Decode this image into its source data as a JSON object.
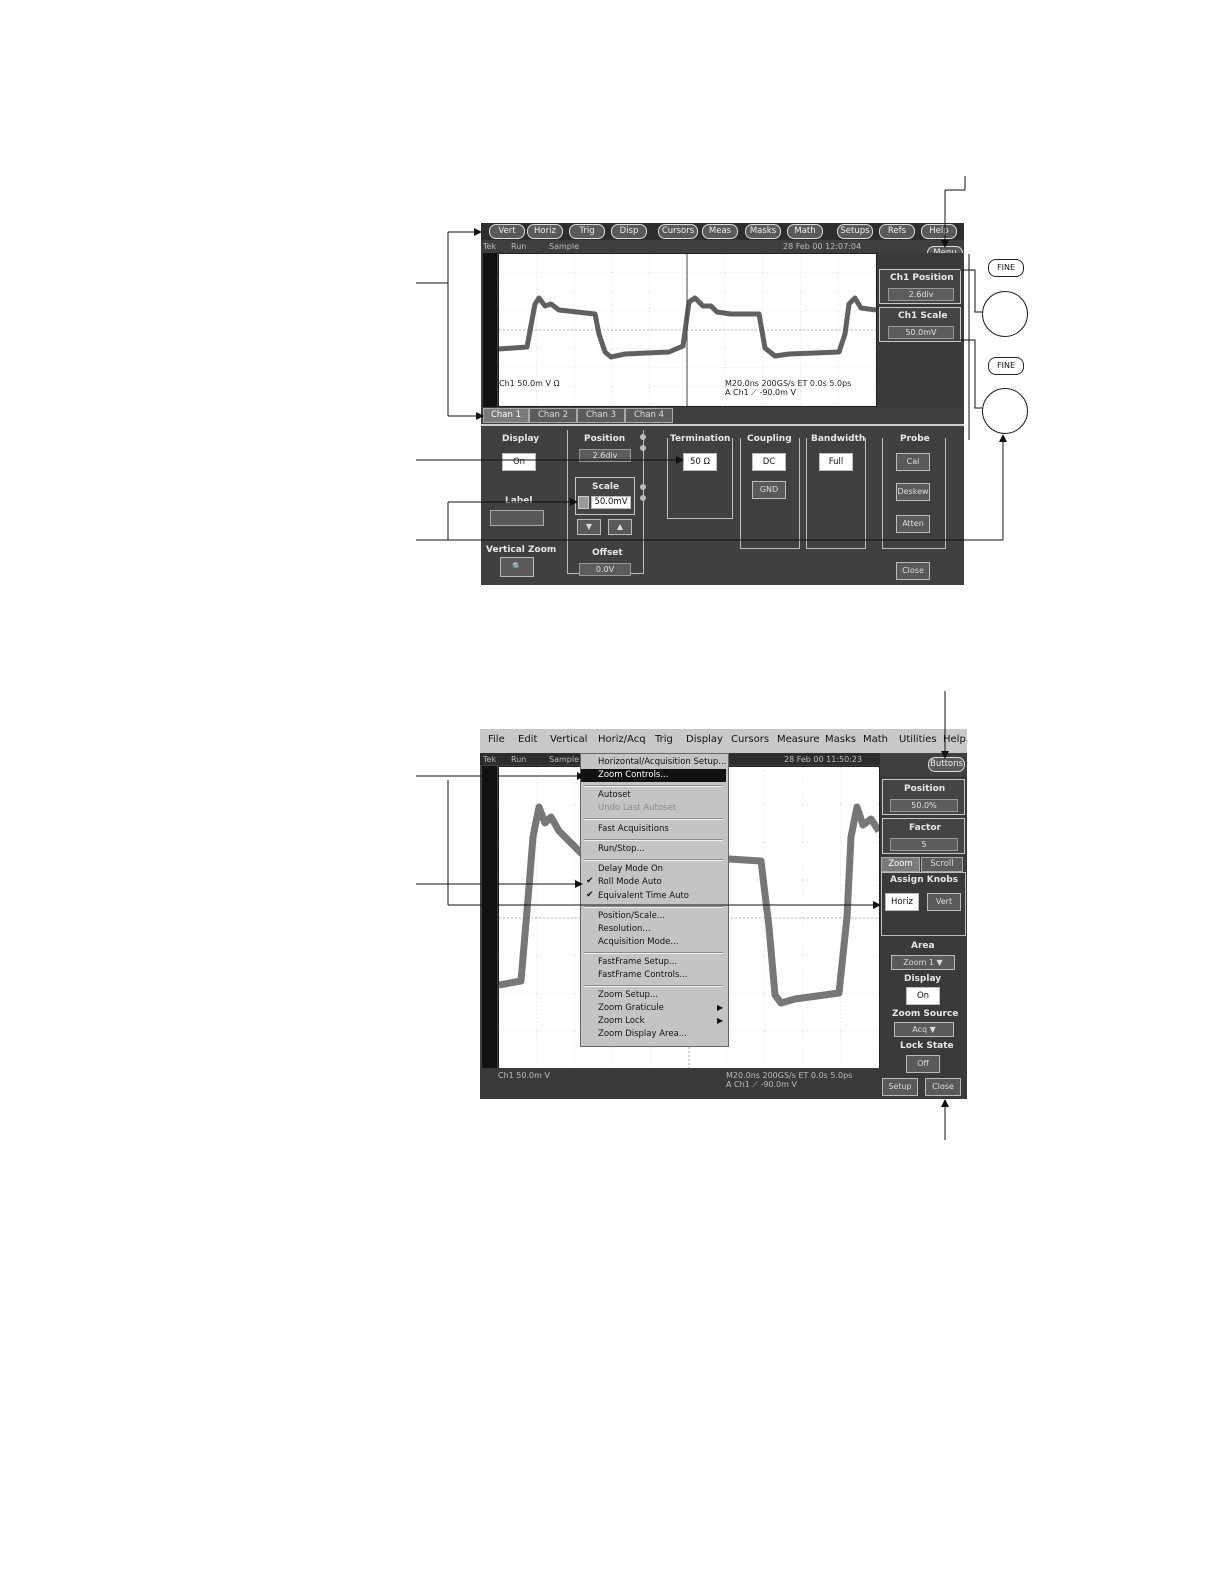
{
  "top": {
    "toolbar": [
      "Vert",
      "Horiz",
      "Trig",
      "Disp",
      "Cursors",
      "Meas",
      "Masks",
      "Math",
      "Setups",
      "Refs",
      "Help"
    ],
    "status": {
      "brand": "Tek",
      "run": "Run",
      "mode": "Sample",
      "timestamp": "28 Feb 00 12:07:04"
    },
    "menu_button": "Menu",
    "readout": {
      "left": "Ch1     50.0m V Ω",
      "right_line1": "M20.0ns 200GS/s    ET 0.0s   5.0ps",
      "right_line2": "A  Ch1  ⟋  -90.0m V"
    },
    "side": {
      "ch1_position_label": "Ch1 Position",
      "ch1_position_value": "2.6div",
      "ch1_scale_label": "Ch1 Scale",
      "ch1_scale_value": "50.0mV"
    },
    "tabs": [
      "Chan 1",
      "Chan 2",
      "Chan 3",
      "Chan 4"
    ],
    "controls": {
      "display_label": "Display",
      "display_value": "On",
      "position_label": "Position",
      "position_value": "2.6div",
      "scale_label": "Scale",
      "scale_value": "50.0mV",
      "label_label": "Label",
      "vertical_zoom_label": "Vertical Zoom",
      "offset_label": "Offset",
      "offset_value": "0.0V",
      "termination_label": "Termination",
      "termination_value": "50 Ω",
      "coupling_label": "Coupling",
      "coupling_dc": "DC",
      "coupling_gnd": "GND",
      "bandwidth_label": "Bandwidth",
      "bandwidth_value": "Full",
      "probe_label": "Probe",
      "probe_cal": "Cal",
      "probe_deskew": "Deskew",
      "probe_atten": "Atten",
      "close": "Close"
    },
    "fine": "FINE"
  },
  "bottom": {
    "menubar": [
      "File",
      "Edit",
      "Vertical",
      "Horiz/Acq",
      "Trig",
      "Display",
      "Cursors",
      "Measure",
      "Masks",
      "Math",
      "Utilities",
      "Help"
    ],
    "status": {
      "brand": "Tek",
      "run": "Run",
      "mode": "Sample",
      "timestamp": "28 Feb 00 11:50:23"
    },
    "buttons_button": "Buttons",
    "menu_items": [
      "Horizontal/Acquisition Setup...",
      "Zoom Controls...",
      "Autoset",
      "Undo Last Autoset",
      "Fast Acquisitions",
      "Run/Stop...",
      "Delay Mode On",
      "Roll Mode Auto",
      "Equivalent Time Auto",
      "Position/Scale...",
      "Resolution...",
      "Acquisition Mode...",
      "FastFrame Setup...",
      "FastFrame Controls...",
      "Zoom Setup...",
      "Zoom Graticule",
      "Zoom Lock",
      "Zoom Display Area..."
    ],
    "readout": {
      "left": "Ch1      50.0m V",
      "right_line1": "M20.0ns 200GS/s    ET 0.0s   5.0ps",
      "right_line2": "A  Ch1  ⟋  -90.0m V"
    },
    "side": {
      "position_label": "Position",
      "position_value": "50.0%",
      "factor_label": "Factor",
      "factor_value": "5",
      "tab_zoom": "Zoom",
      "tab_scroll": "Scroll",
      "assign_knobs_label": "Assign Knobs",
      "horiz": "Horiz",
      "vert": "Vert",
      "area_label": "Area",
      "area_value": "Zoom 1",
      "display_label": "Display",
      "display_value": "On",
      "zoom_source_label": "Zoom Source",
      "zoom_source_value": "Acq",
      "lock_state_label": "Lock State",
      "lock_state_value": "Off",
      "setup": "Setup",
      "close": "Close"
    }
  }
}
